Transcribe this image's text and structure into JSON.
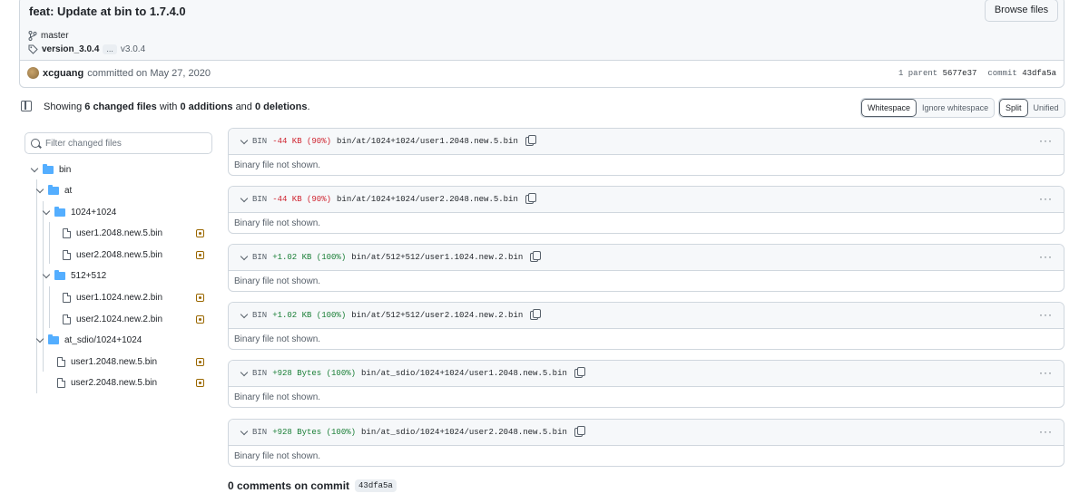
{
  "commit": {
    "title": "feat: Update at bin to 1.7.4.0",
    "browse_label": "Browse files",
    "branch": "master",
    "tag_primary": "version_3.0.4",
    "tag_more": "...",
    "tag_secondary": "v3.0.4",
    "author": "xcguang",
    "committed_text": "committed on May 27, 2020",
    "parent_label": "1 parent",
    "parent_sha": "5677e37",
    "commit_label": "commit",
    "commit_sha": "43dfa5a"
  },
  "toolbar": {
    "summary_prefix": "Showing",
    "changed_files": "6 changed files",
    "with": "with",
    "additions": "0 additions",
    "and": "and",
    "deletions": "0 deletions",
    "period": ".",
    "whitespace": "Whitespace",
    "ignore_whitespace": "Ignore whitespace",
    "split": "Split",
    "unified": "Unified"
  },
  "filter": {
    "placeholder": "Filter changed files"
  },
  "tree": [
    {
      "label": "bin",
      "type": "folder"
    },
    {
      "label": "at",
      "type": "folder"
    },
    {
      "label": "1024+1024",
      "type": "folder"
    },
    {
      "label": "user1.2048.new.5.bin",
      "type": "file"
    },
    {
      "label": "user2.2048.new.5.bin",
      "type": "file"
    },
    {
      "label": "512+512",
      "type": "folder"
    },
    {
      "label": "user1.1024.new.2.bin",
      "type": "file"
    },
    {
      "label": "user2.1024.new.2.bin",
      "type": "file"
    },
    {
      "label": "at_sdio/1024+1024",
      "type": "folder"
    },
    {
      "label": "user1.2048.new.5.bin",
      "type": "file"
    },
    {
      "label": "user2.2048.new.5.bin",
      "type": "file"
    }
  ],
  "diffs": [
    {
      "kind": "BIN",
      "change": "-44 KB (90%)",
      "change_type": "del",
      "path": "bin/at/1024+1024/user1.2048.new.5.bin",
      "body": "Binary file not shown."
    },
    {
      "kind": "BIN",
      "change": "-44 KB (90%)",
      "change_type": "del",
      "path": "bin/at/1024+1024/user2.2048.new.5.bin",
      "body": "Binary file not shown."
    },
    {
      "kind": "BIN",
      "change": "+1.02 KB (100%)",
      "change_type": "add",
      "path": "bin/at/512+512/user1.1024.new.2.bin",
      "body": "Binary file not shown."
    },
    {
      "kind": "BIN",
      "change": "+1.02 KB (100%)",
      "change_type": "add",
      "path": "bin/at/512+512/user2.1024.new.2.bin",
      "body": "Binary file not shown."
    },
    {
      "kind": "BIN",
      "change": "+928 Bytes (100%)",
      "change_type": "add",
      "path": "bin/at_sdio/1024+1024/user1.2048.new.5.bin",
      "body": "Binary file not shown."
    },
    {
      "kind": "BIN",
      "change": "+928 Bytes (100%)",
      "change_type": "add",
      "path": "bin/at_sdio/1024+1024/user2.2048.new.5.bin",
      "body": "Binary file not shown."
    }
  ],
  "comments": {
    "text": "0 comments on commit",
    "sha": "43dfa5a"
  },
  "icons": {
    "branch": "git-branch-icon",
    "tag": "tag-icon",
    "folder": "folder-icon",
    "file": "file-icon",
    "modified": "file-modified-icon",
    "copy": "copy-icon",
    "kebab": "kebab-horizontal-icon"
  },
  "colors": {
    "accent_blue": "#54aeff",
    "deletion": "#cf222e",
    "addition": "#1a7f37",
    "modified": "#9a6700"
  }
}
